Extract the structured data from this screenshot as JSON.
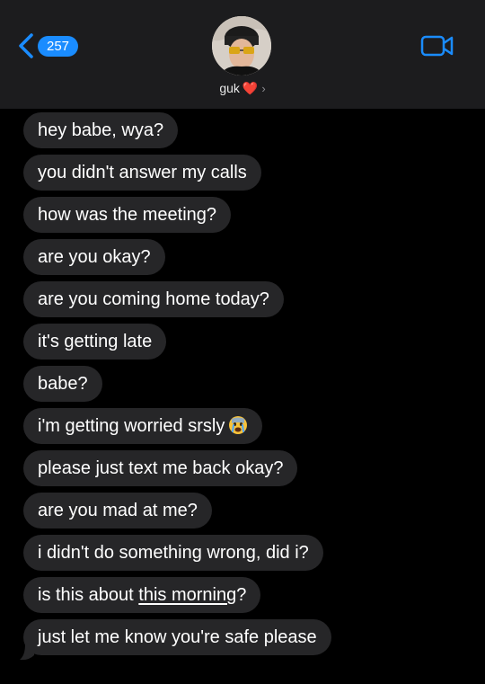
{
  "header": {
    "back_count": "257",
    "contact_name": "guk",
    "contact_heart": "❤️",
    "contact_chevron": "›"
  },
  "messages": [
    {
      "text": "hey babe, wya?"
    },
    {
      "text": "you didn't answer my calls"
    },
    {
      "text": "how was the meeting?"
    },
    {
      "text": "are you okay?"
    },
    {
      "text": "are you coming home today?"
    },
    {
      "text": "it's getting late"
    },
    {
      "text": "babe?"
    },
    {
      "text": "i'm getting worried srsly",
      "emoji": "crying-face"
    },
    {
      "text": "please just text me back okay?"
    },
    {
      "text": "are you mad at me?"
    },
    {
      "text": "i didn't do something wrong, did i?"
    },
    {
      "text_before": "is this about ",
      "link": "this morning",
      "text_after": "?"
    },
    {
      "text": "just let me know you're safe please"
    }
  ]
}
